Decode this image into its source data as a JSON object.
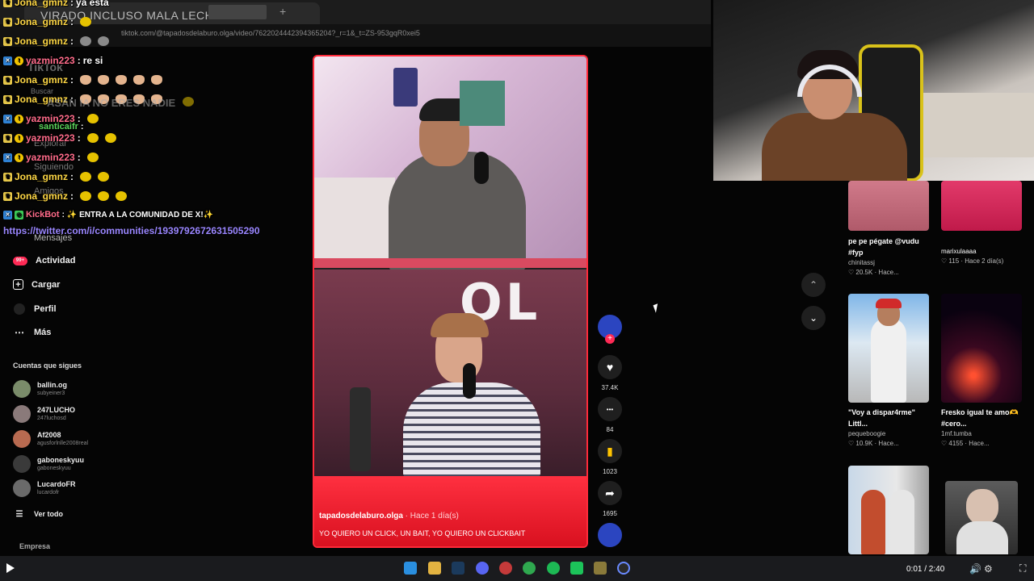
{
  "browser": {
    "tab_title": "VIRADO INCLUSO MALA LECHE",
    "url": "tiktok.com/@tapadosdelaburo.olga/video/7622024442394365204?_r=1&_t=ZS-953gqR0xei5",
    "new_tab_symbol": "+"
  },
  "tiktok_sidebar": {
    "faded": [
      "TikTok",
      "Buscar",
      "Explorar",
      "Siguiendo",
      "Amigos",
      "Mensajes"
    ],
    "items": [
      {
        "label": "Actividad",
        "icon": "bell-icon",
        "badge": "99+"
      },
      {
        "label": "Cargar",
        "icon": "plus-icon"
      },
      {
        "label": "Perfil",
        "icon": "profile-icon"
      },
      {
        "label": "Más",
        "icon": "more-icon"
      }
    ],
    "following_header": "Cuentas que sigues",
    "following": [
      {
        "name": "ballin.og",
        "handle": "subyeiner3"
      },
      {
        "name": "247LUCHO",
        "handle": "247luchosd"
      },
      {
        "name": "Af2008",
        "handle": "agusforlnlle2008real"
      },
      {
        "name": "gaboneskyuu",
        "handle": "gaboneskyuu"
      },
      {
        "name": "LucardoFR",
        "handle": "lucardofr"
      }
    ],
    "see_all": "Ver todo",
    "company": "Empresa"
  },
  "chat": {
    "lines": [
      {
        "user": "Jona_gmnz",
        "color": "yellow",
        "text": "ya esta",
        "emotes": 0
      },
      {
        "user": "Jona_gmnz",
        "color": "yellow",
        "text": "",
        "emotes": 1
      },
      {
        "user": "Jona_gmnz",
        "color": "yellow",
        "text": "",
        "emotes": 2
      },
      {
        "user": "yazmin223",
        "color": "pink",
        "text": "re si",
        "emotes": 0
      },
      {
        "user": "Jona_gmnz",
        "color": "yellow",
        "text": "",
        "emotes": 5
      },
      {
        "user": "Jona_gmnz",
        "color": "yellow",
        "text": "",
        "emotes": 5
      },
      {
        "user": "santicaifr",
        "color": "green",
        "text": "",
        "emotes": 1
      },
      {
        "user": "yazmin223",
        "color": "pink",
        "text": "",
        "emotes": 2
      },
      {
        "user": "yazmin223",
        "color": "pink",
        "text": "",
        "emotes": 1
      },
      {
        "user": "Jona_gmnz",
        "color": "yellow",
        "text": "",
        "emotes": 2
      },
      {
        "user": "Jona_gmnz",
        "color": "yellow",
        "text": "",
        "emotes": 3
      },
      {
        "user": "KickBot",
        "color": "pink",
        "text": "✨ ENTRA A LA COMUNIDAD DE X!✨",
        "emotes": 0
      }
    ],
    "overlay_text": "ASAN IA NO ERES NADIE",
    "link": "https://twitter.com/i/communities/1939792672631505290"
  },
  "video": {
    "username": "tapadosdelaburo.olga",
    "time": " · Hace 1 día(s)",
    "caption": "YO QUIERO UN CLICK, UN BAIT, YO QUIERO UN CLICKBAIT",
    "sign_text": "OL"
  },
  "actions": [
    {
      "icon": "heart-icon",
      "glyph": "♥",
      "count": "37.4K"
    },
    {
      "icon": "comment-icon",
      "glyph": "•••",
      "count": "84"
    },
    {
      "icon": "bookmark-icon",
      "glyph": "▮",
      "count": "1023"
    },
    {
      "icon": "share-icon",
      "glyph": "➦",
      "count": "1695"
    }
  ],
  "grid": [
    {
      "caption": "pe pe pégate @vudu #fyp",
      "user": "chinitassj",
      "stat": "♡ 20.5K · Hace..."
    },
    {
      "caption": "",
      "user": "marixulaaaa",
      "stat": "♡ 115 · Hace 2 día(s)"
    },
    {
      "caption": "\"Voy a dispar4rme\" Littl...",
      "user": "pequeboogie",
      "stat": "♡ 10.9K · Hace..."
    },
    {
      "caption": "Fresko igual te amo🫶 #cero...",
      "user": "1mf.tumba",
      "stat": "♡ 4155 · Hace..."
    }
  ],
  "player": {
    "time": "0:01 / 2:40"
  },
  "colors": {
    "accent_red": "#ff2a3a",
    "chat_yellow": "#ffd845",
    "chat_pink": "#ff6b8a",
    "link_purple": "#9a86ff"
  }
}
